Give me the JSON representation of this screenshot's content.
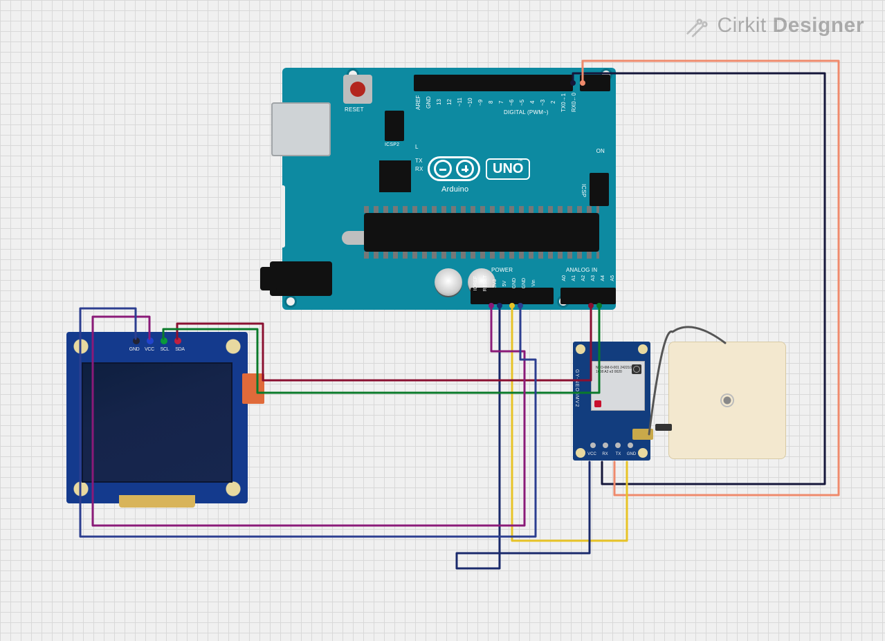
{
  "watermark": {
    "brand": "Cirkit",
    "brand_bold": "Designer"
  },
  "arduino": {
    "name": "Arduino UNO",
    "reset_label": "RESET",
    "icsp2_label": "ICSP2",
    "icsp_label": "ICSP",
    "brand_sub": "Arduino",
    "brand_uno": "UNO",
    "tm": "™",
    "tx_label": "TX",
    "rx_label": "RX",
    "on_label": "ON",
    "l_label": "L",
    "digital_label": "DIGITAL (PWM~)",
    "power_label": "POWER",
    "analog_label": "ANALOG IN",
    "top_pins": [
      "AREF",
      "GND",
      "13",
      "12",
      "~11",
      "~10",
      "~9",
      "8",
      "7",
      "~6",
      "~5",
      "4",
      "~3",
      "2",
      "TX0→1",
      "RX0←0"
    ],
    "power_pins": [
      "IOREF",
      "RESET",
      "3V3",
      "5V",
      "GND",
      "GND",
      "Vin"
    ],
    "analog_pins": [
      "A0",
      "A1",
      "A2",
      "A3",
      "A4",
      "A5"
    ]
  },
  "oled": {
    "name": "OLED 1.3\" Display",
    "pins": [
      "GND",
      "VCC",
      "SCL",
      "SDA"
    ]
  },
  "gps": {
    "name": "GPS NEO 6M",
    "side_label": "GY-NEO6MV2",
    "chip_label": "NEO-6M-0-001\n24221083176\n1608  A2\ne3  0020",
    "pins": [
      "VCC",
      "RX",
      "TX",
      "GND"
    ]
  },
  "antenna": {
    "name": "GPS Antenna"
  },
  "wires": [
    {
      "name": "oled-gnd-to-uno-gnd",
      "color": "#2c3e90",
      "from": "OLED GND",
      "to": "Arduino GND"
    },
    {
      "name": "oled-vcc-to-uno-3v3",
      "color": "#8a1a78",
      "from": "OLED VCC",
      "to": "Arduino 3V3"
    },
    {
      "name": "oled-scl-to-uno-a5",
      "color": "#0a7a2a",
      "from": "OLED SCL",
      "to": "Arduino A5"
    },
    {
      "name": "oled-sda-to-uno-a4",
      "color": "#8a0f30",
      "from": "OLED SDA",
      "to": "Arduino A4"
    },
    {
      "name": "gps-vcc-to-uno-5v",
      "color": "#1a2a6c",
      "from": "GPS VCC",
      "to": "Arduino 5V"
    },
    {
      "name": "gps-gnd-to-uno-gnd",
      "color": "#e7b416",
      "from": "GPS GND",
      "to": "Arduino GND"
    },
    {
      "name": "gps-tx-to-uno-d2",
      "color": "#ef8a6c",
      "from": "GPS TX",
      "to": "Arduino D2"
    },
    {
      "name": "gps-rx-to-uno-d3",
      "color": "#15163a",
      "from": "GPS RX",
      "to": "Arduino D3"
    },
    {
      "name": "antenna-coax",
      "color": "#555",
      "from": "GPS u.FL",
      "to": "Antenna"
    }
  ]
}
